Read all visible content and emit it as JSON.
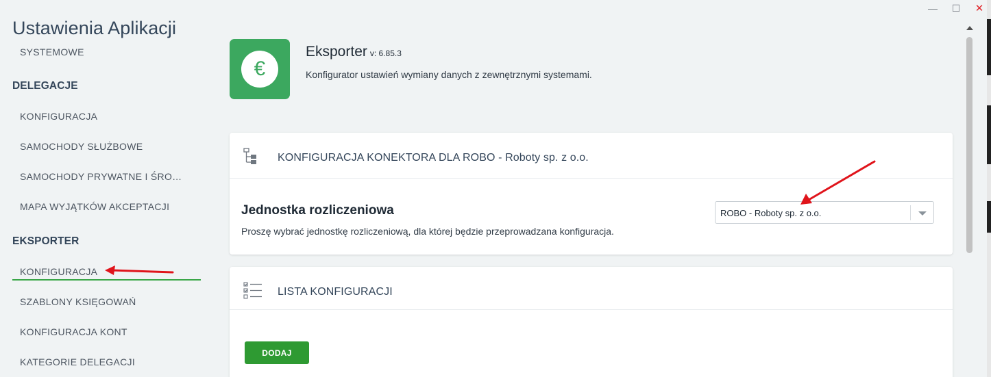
{
  "window": {
    "minimize": "—",
    "maximize": "☐",
    "close": "✕"
  },
  "app_title": "Ustawienia Aplikacji",
  "sidebar": {
    "cut_item": "SYSTEMOWE",
    "groups": [
      {
        "title": "DELEGACJE",
        "items": [
          "KONFIGURACJA",
          "SAMOCHODY SŁUŻBOWE",
          "SAMOCHODY PRYWATNE I ŚRODKI TRANSPORTU",
          "MAPA WYJĄTKÓW AKCEPTACJI"
        ]
      },
      {
        "title": "EKSPORTER",
        "items": [
          "KONFIGURACJA",
          "SZABLONY KSIĘGOWAŃ",
          "KONFIGURACJA KONT",
          "KATEGORIE DELEGACJI"
        ]
      }
    ],
    "active_item": "KONFIGURACJA"
  },
  "header": {
    "icon": "euro-icon",
    "icon_glyph": "€",
    "title": "Eksporter",
    "version": "v: 6.85.3",
    "description": "Konfigurator ustawień wymiany danych z zewnętrznymi systemami."
  },
  "card_connector": {
    "icon": "hierarchy-icon",
    "title": "KONFIGURACJA KONEKTORA DLA ROBO - Roboty sp. z o.o.",
    "field_title": "Jednostka rozliczeniowa",
    "field_desc": "Proszę wybrać jednostkę rozliczeniową, dla której będzie przeprowadzana konfiguracja.",
    "select_value": "ROBO - Roboty sp. z o.o."
  },
  "card_list": {
    "icon": "checklist-icon",
    "title": "LISTA KONFIGURACJI",
    "add_button": "DODAJ"
  },
  "colors": {
    "accent_green": "#3ca85f",
    "button_green": "#2e9a32",
    "annotation_red": "#e0141b",
    "title_blue": "#34465a"
  }
}
